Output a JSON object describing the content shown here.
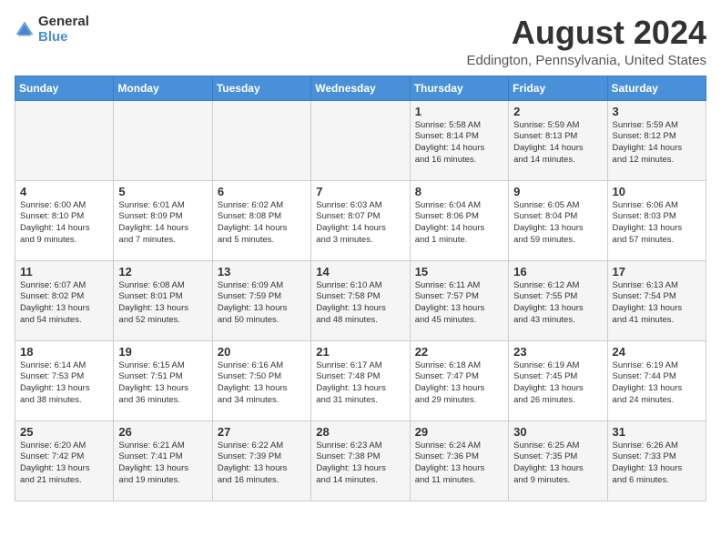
{
  "header": {
    "logo_general": "General",
    "logo_blue": "Blue",
    "title": "August 2024",
    "location": "Eddington, Pennsylvania, United States"
  },
  "calendar": {
    "days_of_week": [
      "Sunday",
      "Monday",
      "Tuesday",
      "Wednesday",
      "Thursday",
      "Friday",
      "Saturday"
    ],
    "weeks": [
      [
        {
          "day": "",
          "detail": ""
        },
        {
          "day": "",
          "detail": ""
        },
        {
          "day": "",
          "detail": ""
        },
        {
          "day": "",
          "detail": ""
        },
        {
          "day": "1",
          "detail": "Sunrise: 5:58 AM\nSunset: 8:14 PM\nDaylight: 14 hours\nand 16 minutes."
        },
        {
          "day": "2",
          "detail": "Sunrise: 5:59 AM\nSunset: 8:13 PM\nDaylight: 14 hours\nand 14 minutes."
        },
        {
          "day": "3",
          "detail": "Sunrise: 5:59 AM\nSunset: 8:12 PM\nDaylight: 14 hours\nand 12 minutes."
        }
      ],
      [
        {
          "day": "4",
          "detail": "Sunrise: 6:00 AM\nSunset: 8:10 PM\nDaylight: 14 hours\nand 9 minutes."
        },
        {
          "day": "5",
          "detail": "Sunrise: 6:01 AM\nSunset: 8:09 PM\nDaylight: 14 hours\nand 7 minutes."
        },
        {
          "day": "6",
          "detail": "Sunrise: 6:02 AM\nSunset: 8:08 PM\nDaylight: 14 hours\nand 5 minutes."
        },
        {
          "day": "7",
          "detail": "Sunrise: 6:03 AM\nSunset: 8:07 PM\nDaylight: 14 hours\nand 3 minutes."
        },
        {
          "day": "8",
          "detail": "Sunrise: 6:04 AM\nSunset: 8:06 PM\nDaylight: 14 hours\nand 1 minute."
        },
        {
          "day": "9",
          "detail": "Sunrise: 6:05 AM\nSunset: 8:04 PM\nDaylight: 13 hours\nand 59 minutes."
        },
        {
          "day": "10",
          "detail": "Sunrise: 6:06 AM\nSunset: 8:03 PM\nDaylight: 13 hours\nand 57 minutes."
        }
      ],
      [
        {
          "day": "11",
          "detail": "Sunrise: 6:07 AM\nSunset: 8:02 PM\nDaylight: 13 hours\nand 54 minutes."
        },
        {
          "day": "12",
          "detail": "Sunrise: 6:08 AM\nSunset: 8:01 PM\nDaylight: 13 hours\nand 52 minutes."
        },
        {
          "day": "13",
          "detail": "Sunrise: 6:09 AM\nSunset: 7:59 PM\nDaylight: 13 hours\nand 50 minutes."
        },
        {
          "day": "14",
          "detail": "Sunrise: 6:10 AM\nSunset: 7:58 PM\nDaylight: 13 hours\nand 48 minutes."
        },
        {
          "day": "15",
          "detail": "Sunrise: 6:11 AM\nSunset: 7:57 PM\nDaylight: 13 hours\nand 45 minutes."
        },
        {
          "day": "16",
          "detail": "Sunrise: 6:12 AM\nSunset: 7:55 PM\nDaylight: 13 hours\nand 43 minutes."
        },
        {
          "day": "17",
          "detail": "Sunrise: 6:13 AM\nSunset: 7:54 PM\nDaylight: 13 hours\nand 41 minutes."
        }
      ],
      [
        {
          "day": "18",
          "detail": "Sunrise: 6:14 AM\nSunset: 7:53 PM\nDaylight: 13 hours\nand 38 minutes."
        },
        {
          "day": "19",
          "detail": "Sunrise: 6:15 AM\nSunset: 7:51 PM\nDaylight: 13 hours\nand 36 minutes."
        },
        {
          "day": "20",
          "detail": "Sunrise: 6:16 AM\nSunset: 7:50 PM\nDaylight: 13 hours\nand 34 minutes."
        },
        {
          "day": "21",
          "detail": "Sunrise: 6:17 AM\nSunset: 7:48 PM\nDaylight: 13 hours\nand 31 minutes."
        },
        {
          "day": "22",
          "detail": "Sunrise: 6:18 AM\nSunset: 7:47 PM\nDaylight: 13 hours\nand 29 minutes."
        },
        {
          "day": "23",
          "detail": "Sunrise: 6:19 AM\nSunset: 7:45 PM\nDaylight: 13 hours\nand 26 minutes."
        },
        {
          "day": "24",
          "detail": "Sunrise: 6:19 AM\nSunset: 7:44 PM\nDaylight: 13 hours\nand 24 minutes."
        }
      ],
      [
        {
          "day": "25",
          "detail": "Sunrise: 6:20 AM\nSunset: 7:42 PM\nDaylight: 13 hours\nand 21 minutes."
        },
        {
          "day": "26",
          "detail": "Sunrise: 6:21 AM\nSunset: 7:41 PM\nDaylight: 13 hours\nand 19 minutes."
        },
        {
          "day": "27",
          "detail": "Sunrise: 6:22 AM\nSunset: 7:39 PM\nDaylight: 13 hours\nand 16 minutes."
        },
        {
          "day": "28",
          "detail": "Sunrise: 6:23 AM\nSunset: 7:38 PM\nDaylight: 13 hours\nand 14 minutes."
        },
        {
          "day": "29",
          "detail": "Sunrise: 6:24 AM\nSunset: 7:36 PM\nDaylight: 13 hours\nand 11 minutes."
        },
        {
          "day": "30",
          "detail": "Sunrise: 6:25 AM\nSunset: 7:35 PM\nDaylight: 13 hours\nand 9 minutes."
        },
        {
          "day": "31",
          "detail": "Sunrise: 6:26 AM\nSunset: 7:33 PM\nDaylight: 13 hours\nand 6 minutes."
        }
      ]
    ]
  }
}
